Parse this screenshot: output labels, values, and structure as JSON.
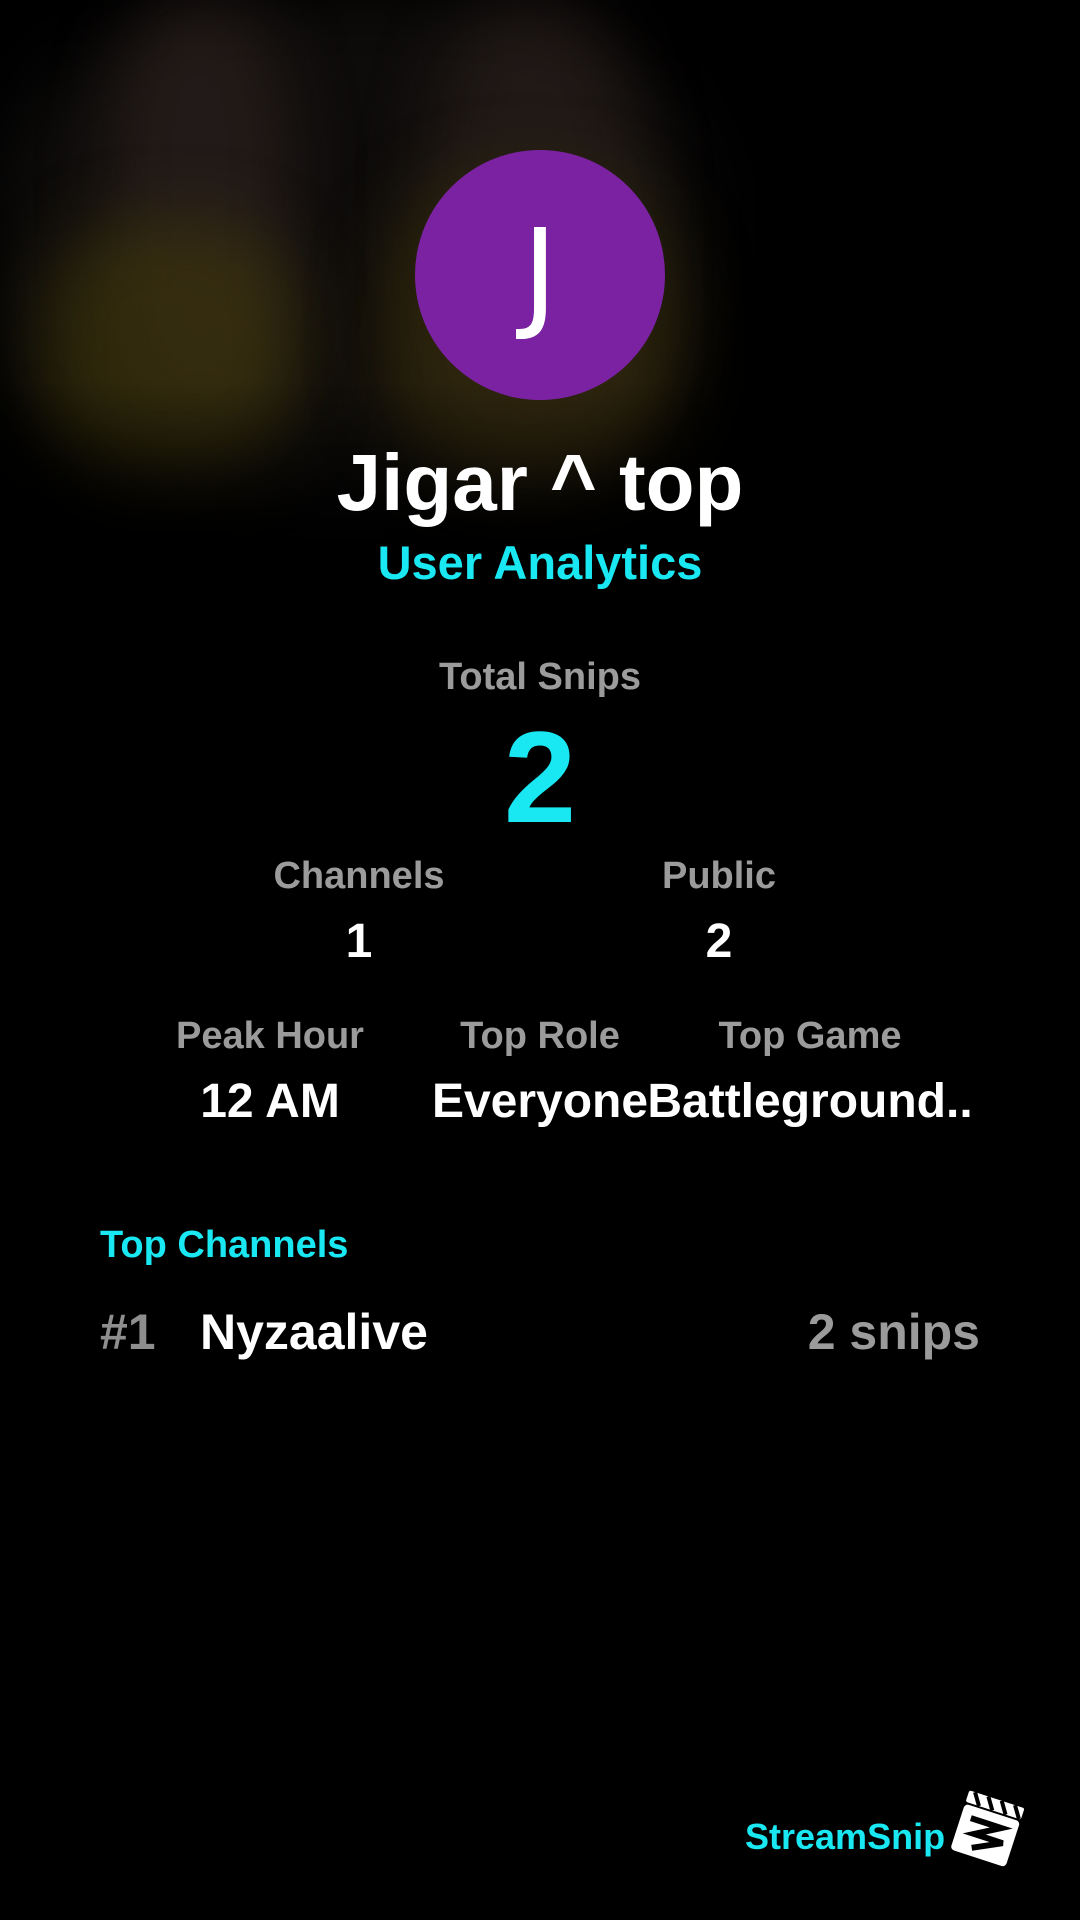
{
  "profile": {
    "avatar_letter": "J",
    "avatar_color": "#7b22a3",
    "name": "Jigar ^ top",
    "subtitle": "User Analytics"
  },
  "stats": {
    "total_label": "Total Snips",
    "total_value": "2",
    "channels_label": "Channels",
    "channels_value": "1",
    "public_label": "Public",
    "public_value": "2",
    "peak_hour_label": "Peak Hour",
    "peak_hour_value": "12 AM",
    "top_role_label": "Top Role",
    "top_role_value": "Everyone",
    "top_game_label": "Top Game",
    "top_game_value": "Battleground.."
  },
  "top_channels": {
    "title": "Top Channels",
    "items": [
      {
        "rank": "#1",
        "name": "Nyzaalive",
        "snips": "2 snips"
      }
    ]
  },
  "brand": {
    "name": "StreamSnip",
    "logo_icon": "clapperboard-icon"
  },
  "colors": {
    "accent": "#19e8f2",
    "muted": "#9b9b9b",
    "background": "#000000"
  }
}
